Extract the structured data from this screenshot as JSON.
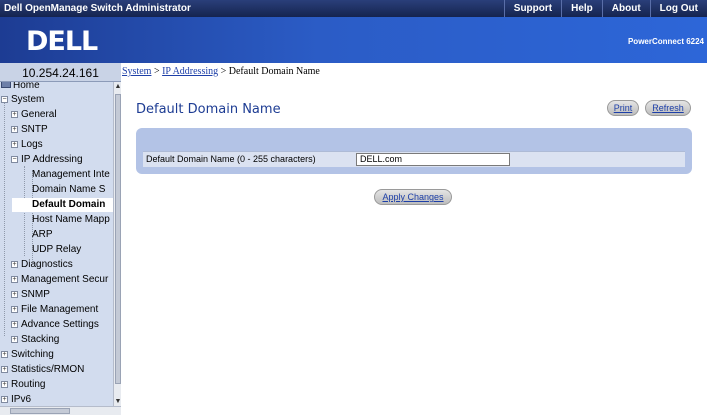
{
  "app_title": "Dell OpenManage Switch Administrator",
  "top_links": [
    "Support",
    "Help",
    "About",
    "Log Out"
  ],
  "brand": {
    "logo": "DELL",
    "product": "PowerConnect 6224"
  },
  "ip_address": "10.254.24.161",
  "breadcrumb": {
    "system": "System",
    "sep1": " > ",
    "ip": "IP Addressing",
    "sep2": " > ",
    "current": "Default Domain Name"
  },
  "page_title": "Default Domain Name",
  "buttons": {
    "print": "Print",
    "refresh": "Refresh",
    "apply": "Apply Changes"
  },
  "form": {
    "label": "Default Domain Name (0 - 255 characters)",
    "value": "DELL.com"
  },
  "tree": {
    "home": "Home",
    "system": "System",
    "general": "General",
    "sntp": "SNTP",
    "logs": "Logs",
    "ip_addressing": "IP Addressing",
    "management_interface": "Management Inte",
    "domain_name_server": "Domain Name S",
    "default_domain": "Default Domain",
    "host_name_mapping": "Host Name Mapp",
    "arp": "ARP",
    "udp_relay": "UDP Relay",
    "diagnostics": "Diagnostics",
    "management_security": "Management Secur",
    "snmp": "SNMP",
    "file_management": "File Management",
    "advance_settings": "Advance Settings",
    "stacking": "Stacking",
    "switching": "Switching",
    "statistics_rmon": "Statistics/RMON",
    "routing": "Routing",
    "ipv6": "IPv6"
  }
}
